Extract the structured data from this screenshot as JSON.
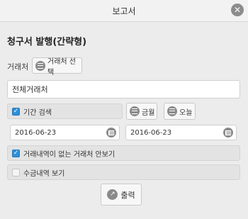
{
  "window": {
    "title": "보고서"
  },
  "heading": "청구서 발행(간략형)",
  "client": {
    "label": "거래처",
    "select_button": "거래처 선택",
    "value": "전체거래처"
  },
  "period": {
    "checkbox_label": "기간 검색",
    "checked": true,
    "this_month_button": "금월",
    "today_button": "오늘",
    "start_date": "2016-06-23",
    "end_date": "2016-06-23"
  },
  "options": {
    "hide_no_transactions_label": "거래내역이 없는 거래처 안보기",
    "hide_no_transactions_checked": true,
    "show_payments_label": "수금내역 보기",
    "show_payments_checked": false
  },
  "actions": {
    "print_button": "출력"
  },
  "icons": {
    "close": "close-icon",
    "list": "list-icon",
    "calendar": "calendar-icon",
    "print": "print-icon"
  },
  "colors": {
    "checkbox_accent": "#2f8fd8"
  }
}
